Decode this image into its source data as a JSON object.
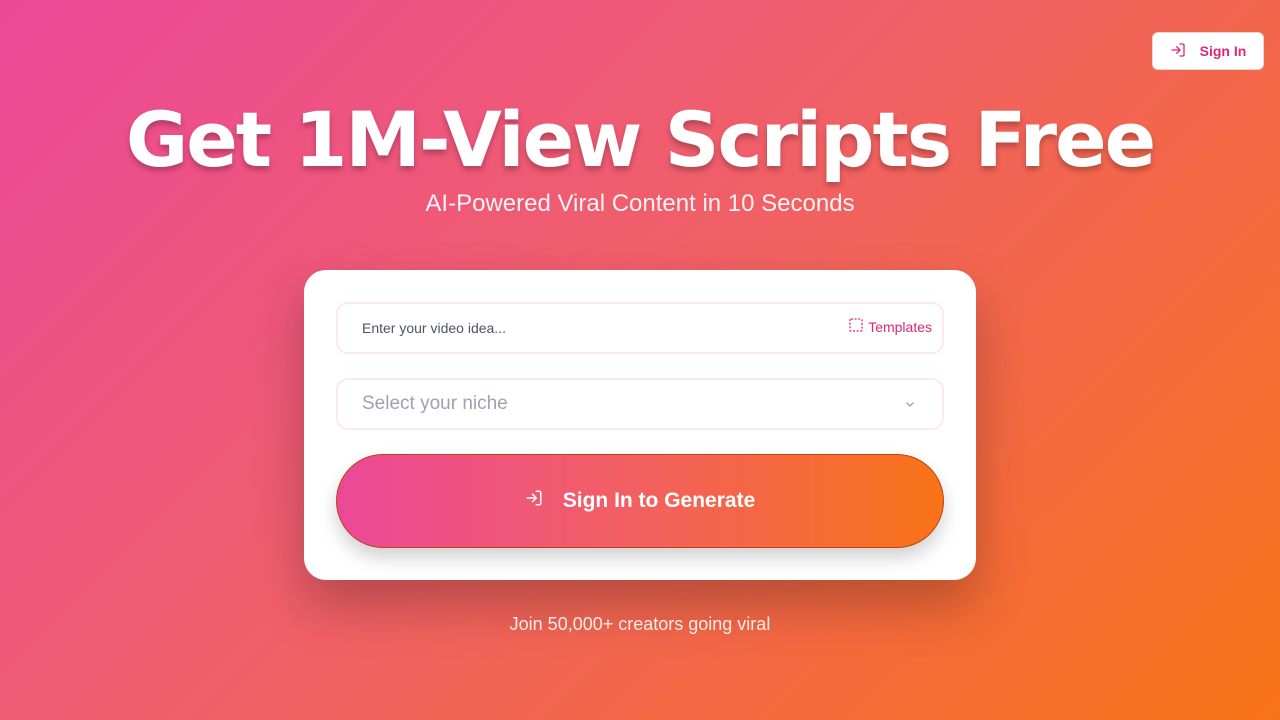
{
  "header": {
    "signin_label": "Sign In",
    "signin_icon": "log-in-icon"
  },
  "hero": {
    "title": "Get 1M-View Scripts Free",
    "subtitle": "AI-Powered Viral Content in 10 Seconds"
  },
  "form": {
    "idea_placeholder": "Enter your video idea...",
    "templates_label": "Templates",
    "templates_icon": "dashed-square-icon",
    "niche_placeholder": "Select your niche",
    "niche_icon": "chevron-down-icon",
    "generate_label": "Sign In to Generate",
    "generate_icon": "log-in-icon"
  },
  "footer": {
    "social_proof": "Join 50,000+ creators going viral"
  },
  "colors": {
    "gradient_start": "#ec4899",
    "gradient_end": "#f97316",
    "accent": "#db2777"
  }
}
